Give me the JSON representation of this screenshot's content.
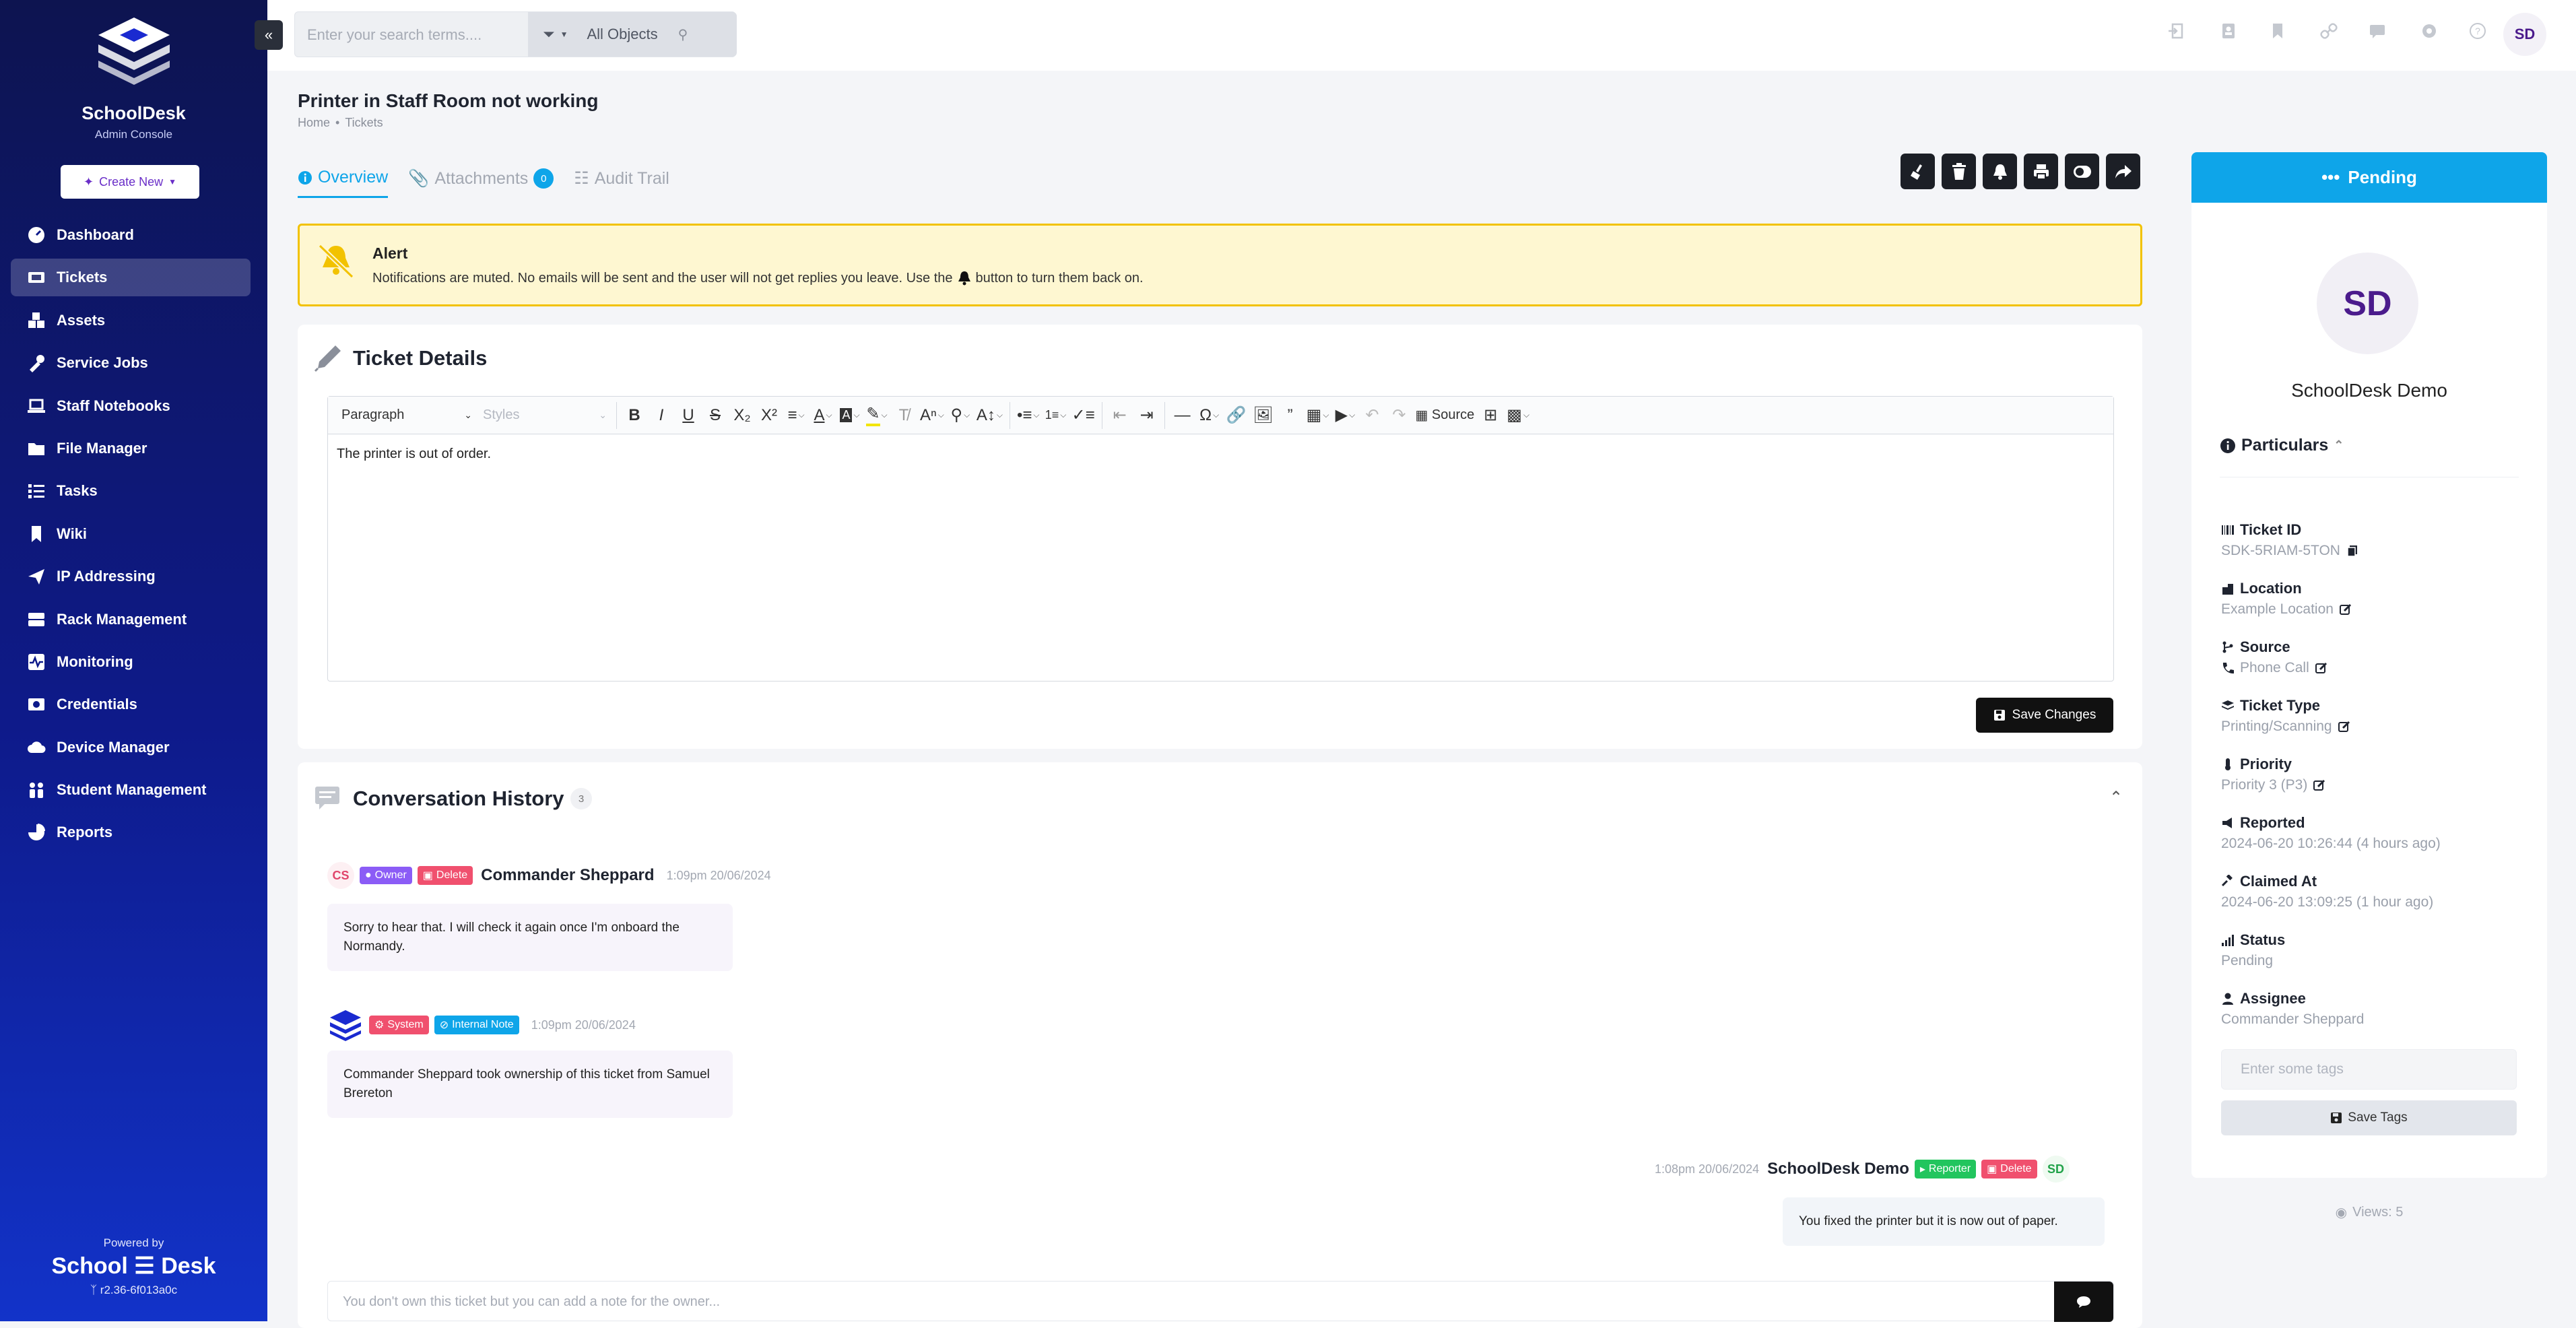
{
  "brand": {
    "name": "SchoolDesk",
    "subtitle": "Admin Console",
    "create_new": "Create New"
  },
  "nav": [
    {
      "label": "Dashboard",
      "icon": "dashboard-icon"
    },
    {
      "label": "Tickets",
      "icon": "ticket-icon",
      "active": true
    },
    {
      "label": "Assets",
      "icon": "boxes-icon"
    },
    {
      "label": "Service Jobs",
      "icon": "tools-icon"
    },
    {
      "label": "Staff Notebooks",
      "icon": "laptop-icon"
    },
    {
      "label": "File Manager",
      "icon": "folder-icon"
    },
    {
      "label": "Tasks",
      "icon": "tasks-icon"
    },
    {
      "label": "Wiki",
      "icon": "bookmark-icon"
    },
    {
      "label": "IP Addressing",
      "icon": "paper-plane-icon"
    },
    {
      "label": "Rack Management",
      "icon": "server-icon"
    },
    {
      "label": "Monitoring",
      "icon": "heartbeat-icon"
    },
    {
      "label": "Credentials",
      "icon": "id-card-icon"
    },
    {
      "label": "Device Manager",
      "icon": "cloud-icon"
    },
    {
      "label": "Student Management",
      "icon": "users-icon"
    },
    {
      "label": "Reports",
      "icon": "pie-chart-icon"
    }
  ],
  "footer": {
    "powered": "Powered by",
    "brand": "School ☰ Desk",
    "version": "r2.36-6f013a0c"
  },
  "topbar": {
    "search_placeholder": "Enter your search terms....",
    "scope": "All Objects",
    "avatar": "SD"
  },
  "page": {
    "title": "Printer in Staff Room not working",
    "breadcrumb": [
      "Home",
      "Tickets"
    ],
    "tabs": [
      {
        "label": "Overview",
        "active": true
      },
      {
        "label": "Attachments",
        "badge": "0"
      },
      {
        "label": "Audit Trail"
      }
    ]
  },
  "alert": {
    "title": "Alert",
    "text_before": "Notifications are muted. No emails will be sent and the user will not get replies you leave. Use the",
    "text_after": "button to turn them back on."
  },
  "details": {
    "title": "Ticket Details",
    "paragraph_select": "Paragraph",
    "styles_select": "Styles",
    "source_label": "Source",
    "body": "The printer is out of order.",
    "save_label": "Save Changes"
  },
  "history": {
    "title": "Conversation History",
    "count": "3",
    "messages": [
      {
        "avatar": "CS",
        "badges": [
          "Owner",
          "Delete"
        ],
        "name": "Commander Sheppard",
        "time": "1:09pm 20/06/2024",
        "text": "Sorry to hear that. I will check it again once I'm onboard the Normandy."
      },
      {
        "avatar": "",
        "badges": [
          "System",
          "Internal Note"
        ],
        "name": "",
        "time": "1:09pm 20/06/2024",
        "text": "Commander Sheppard took ownership of this ticket from Samuel Brereton"
      },
      {
        "avatar": "SD",
        "badges": [
          "Reporter",
          "Delete"
        ],
        "name": "SchoolDesk Demo",
        "time": "1:08pm 20/06/2024",
        "text": "You fixed the printer but it is now out of paper."
      }
    ],
    "note_placeholder": "You don't own this ticket but you can add a note for the owner..."
  },
  "panel": {
    "status": "Pending",
    "avatar": "SD",
    "name": "SchoolDesk Demo",
    "particulars": "Particulars",
    "fields": [
      {
        "label": "Ticket ID",
        "value": "SDK-5RIAM-5TON"
      },
      {
        "label": "Location",
        "value": "Example Location"
      },
      {
        "label": "Source",
        "value": "Phone Call"
      },
      {
        "label": "Ticket Type",
        "value": "Printing/Scanning"
      },
      {
        "label": "Priority",
        "value": "Priority 3 (P3)"
      },
      {
        "label": "Reported",
        "value": "2024-06-20 10:26:44 (4 hours ago)"
      },
      {
        "label": "Claimed At",
        "value": "2024-06-20 13:09:25 (1 hour ago)"
      },
      {
        "label": "Status",
        "value": "Pending"
      },
      {
        "label": "Assignee",
        "value": "Commander Sheppard"
      }
    ],
    "tags_placeholder": "Enter some tags",
    "save_tags": "Save Tags",
    "views": "Views: 5"
  },
  "colors": {
    "accent": "#0ea5e9",
    "sidebar_top": "#0d1450",
    "sidebar_bottom": "#1233c9",
    "alert_bg": "#fef7d1",
    "alert_border": "#f2c200"
  }
}
